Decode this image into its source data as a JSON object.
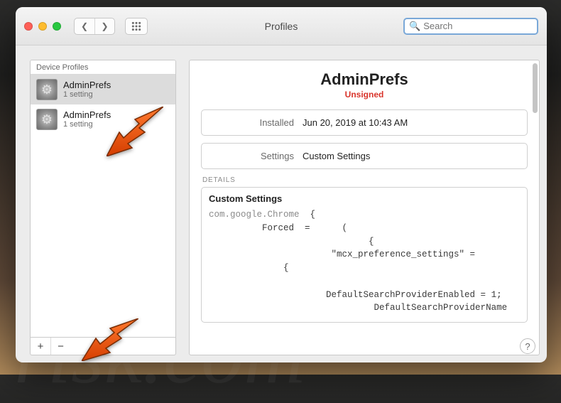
{
  "window": {
    "title": "Profiles"
  },
  "search": {
    "placeholder": "Search",
    "value": ""
  },
  "sidebar": {
    "header": "Device Profiles",
    "items": [
      {
        "name": "AdminPrefs",
        "sub": "1 setting",
        "selected": true
      },
      {
        "name": "AdminPrefs",
        "sub": "1 setting",
        "selected": false
      }
    ],
    "add_label": "+",
    "remove_label": "−"
  },
  "detail": {
    "title": "AdminPrefs",
    "status": "Unsigned",
    "installed_label": "Installed",
    "installed_value": "Jun 20, 2019 at 10:43 AM",
    "settings_label": "Settings",
    "settings_value": "Custom Settings",
    "details_header": "DETAILS",
    "details_title": "Custom Settings",
    "code_domain": "com.google.Chrome",
    "code_lines": "  {\n          Forced  =      (\n                              {\n                       \"mcx_preference_settings\" =\n              {\n\n                      DefaultSearchProviderEnabled = 1;\n                               DefaultSearchProviderName"
  },
  "help_label": "?",
  "colors": {
    "accent": "#7aa8d8",
    "danger": "#d9342b",
    "arrow": "#f15a24"
  }
}
